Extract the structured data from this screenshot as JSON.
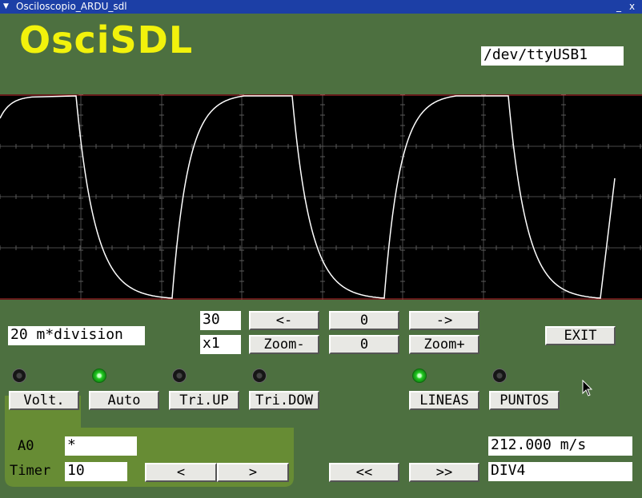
{
  "window": {
    "title": "Osciloscopio_ARDU_sdl",
    "minimize": "_",
    "close": "x"
  },
  "app": {
    "logo": "OsciSDL",
    "port": "/dev/ttyUSB1"
  },
  "controls": {
    "timebase": "20 m*division",
    "offset": "30",
    "zoom_factor": "x1",
    "left": "<-",
    "center_value": "0",
    "right": "->",
    "zoom_minus": "Zoom-",
    "zoom_value": "0",
    "zoom_plus": "Zoom+",
    "exit": "EXIT"
  },
  "modes": [
    {
      "label": "Volt.",
      "on": false
    },
    {
      "label": "Auto",
      "on": true
    },
    {
      "label": "Tri.UP",
      "on": false
    },
    {
      "label": "Tri.DOW",
      "on": false
    },
    {
      "label": "LINEAS",
      "on": true
    },
    {
      "label": "PUNTOS",
      "on": false
    }
  ],
  "channel": {
    "label": "A0",
    "value": "*"
  },
  "timer": {
    "label": "Timer",
    "value": "10",
    "dec": "<",
    "inc": ">"
  },
  "nav": {
    "rewind": "<<",
    "forward": ">>"
  },
  "readouts": {
    "rate": "212.000 m/s",
    "division": "DIV4"
  },
  "colors": {
    "background": "#4d7040",
    "logo": "#f2f20c",
    "trace": "#ffffff",
    "grid": "#555555",
    "limit": "#c83232",
    "titlebar": "#1c3fa6"
  }
}
